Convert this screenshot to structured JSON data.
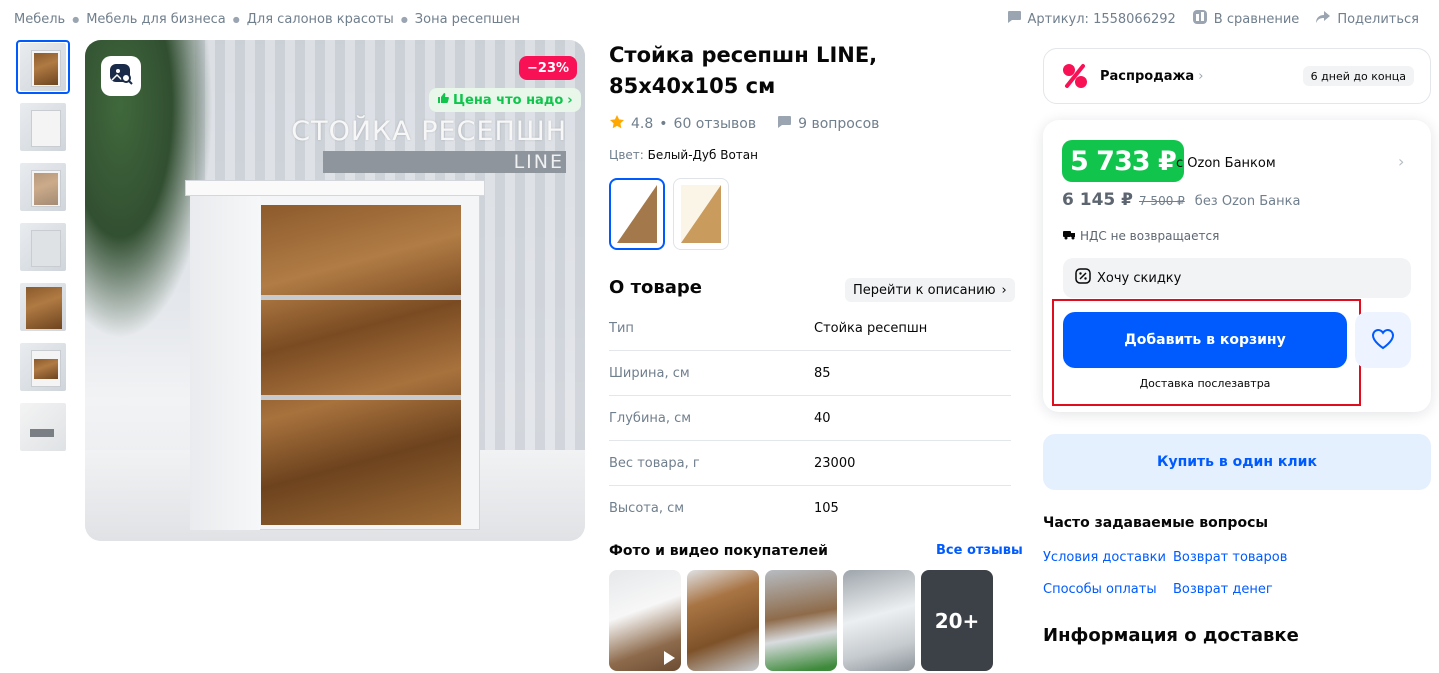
{
  "breadcrumbs": [
    "Мебель",
    "Мебель для бизнеса",
    "Для салонов красоты",
    "Зона ресепшен"
  ],
  "top_actions": {
    "article": "Артикул: 1558066292",
    "compare": "В сравнение",
    "share": "Поделиться"
  },
  "gallery": {
    "thumb_count": 7,
    "image_title_line1": "СТОЙКА РЕСЕПШН",
    "image_title_line2": "LINE",
    "discount_badge": "−23%",
    "price_good_badge": "Цена что надо",
    "more_photos": "20+"
  },
  "product": {
    "title": "Стойка ресепшн LINE, 85x40x105 см",
    "rating": "4.8",
    "reviews": "60 отзывов",
    "questions": "9 вопросов",
    "color_label": "Цвет:",
    "color_value": "Белый-Дуб Вотан"
  },
  "about": {
    "title": "О товаре",
    "go_to_description": "Перейти к описанию",
    "specs": [
      {
        "key": "Тип",
        "value": "Стойка ресепшн"
      },
      {
        "key": "Ширина, см",
        "value": "85"
      },
      {
        "key": "Глубина, см",
        "value": "40"
      },
      {
        "key": "Вес товара, г",
        "value": "23000"
      },
      {
        "key": "Высота, см",
        "value": "105"
      }
    ]
  },
  "customer_photos": {
    "title": "Фото и видео покупателей",
    "all_reviews": "Все отзывы"
  },
  "sale": {
    "label": "Распродажа",
    "days_left": "6 дней до конца"
  },
  "price": {
    "ozon_price": "5 733 ₽",
    "ozon_label": "c Ozon Банком",
    "regular_price": "6 145 ₽",
    "old_price": "7 500 ₽",
    "regular_label": "без Ozon Банка",
    "vat_note": "НДС не возвращается",
    "want_discount": "Хочу скидку",
    "add_to_cart": "Добавить в корзину",
    "delivery_prefix": "Доставка",
    "delivery_day": "послезавтра",
    "buy_one_click": "Купить в один клик"
  },
  "faq": {
    "title": "Часто задаваемые вопросы",
    "links": [
      "Условия доставки",
      "Возврат товаров",
      "Способы оплаты",
      "Возврат денег"
    ]
  },
  "delivery_info": {
    "title": "Информация о доставке"
  },
  "colors": {
    "accent": "#005bff",
    "ozon_price_green": "#10c44c",
    "discount_pink": "#f91155",
    "highlight_red": "#e00d1e"
  }
}
